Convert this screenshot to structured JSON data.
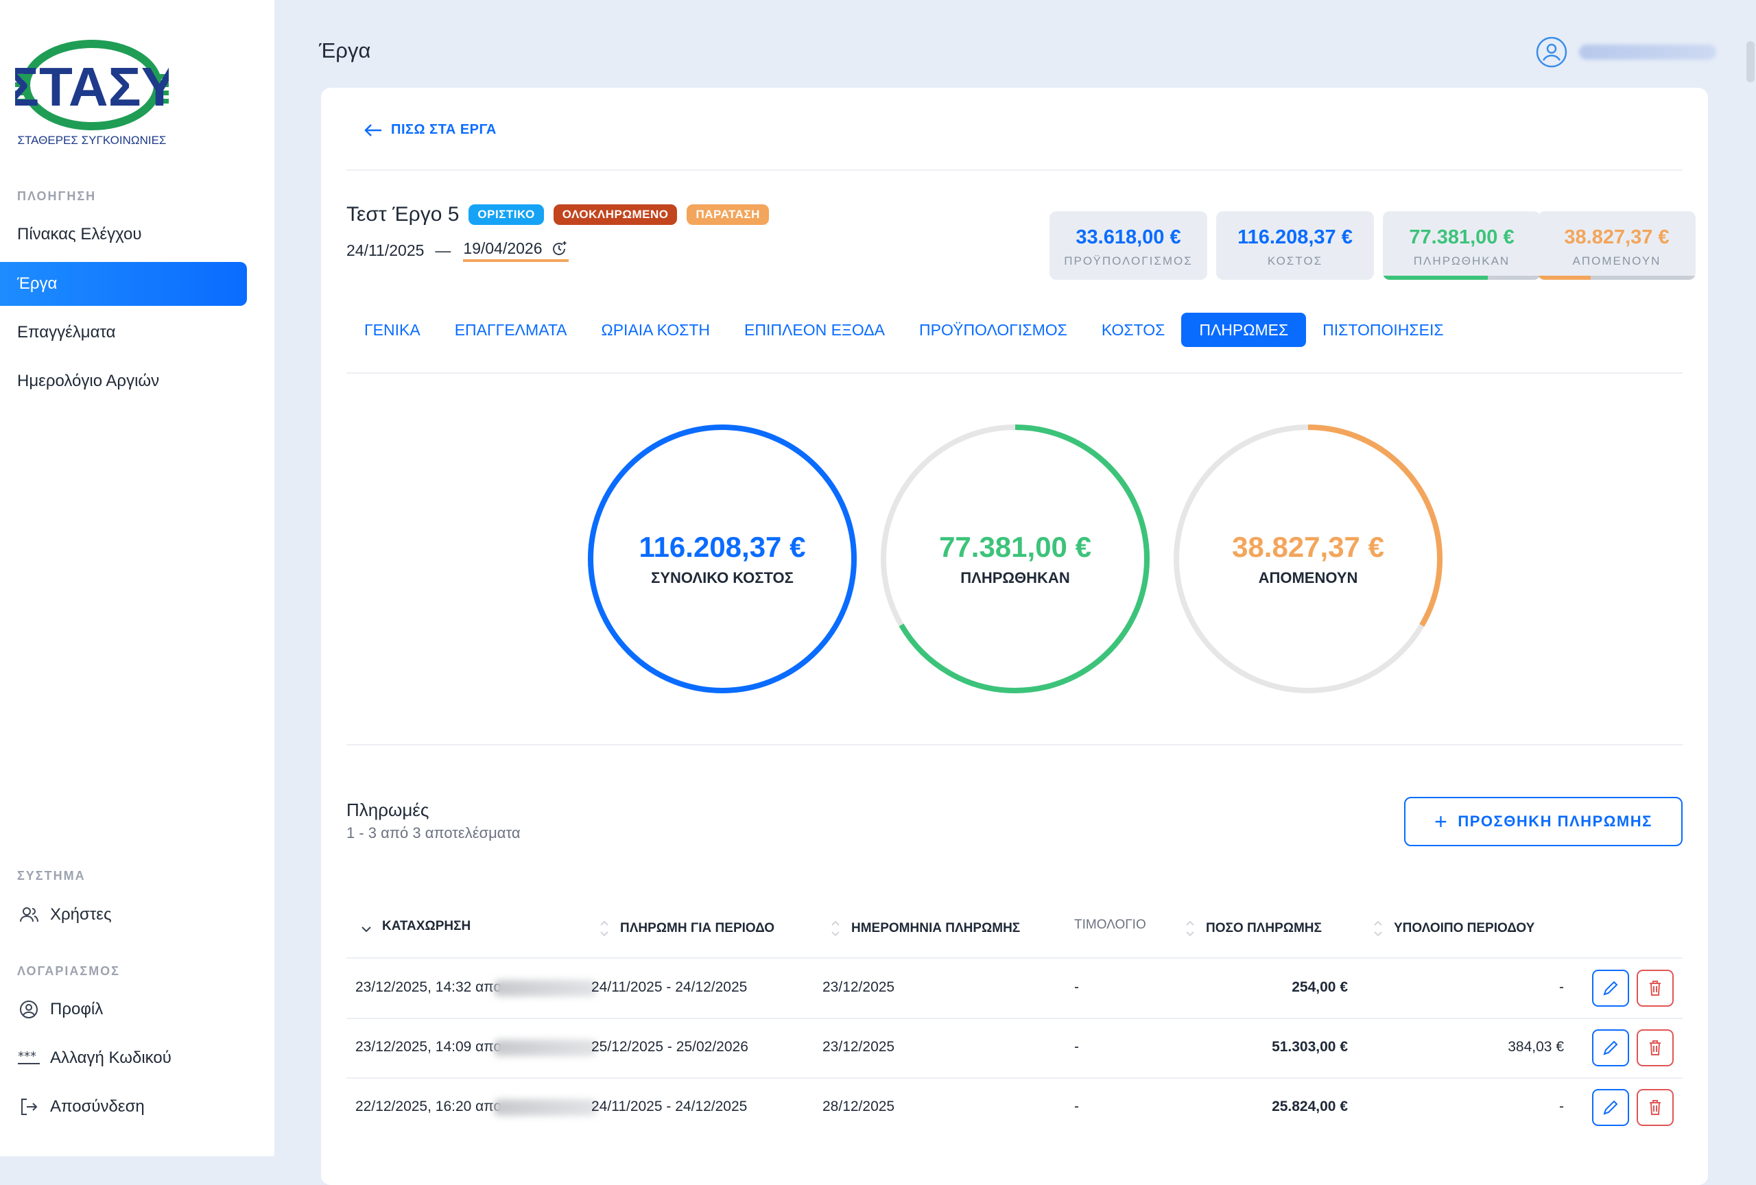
{
  "sidebar": {
    "logo": {
      "text_top": "ΣΤΑΣΥ",
      "text_bottom": "ΣΤΑΘΕΡΕΣ ΣΥΓΚΟΙΝΩΝΙΕΣ"
    },
    "nav_heading": "ΠΛΟΗΓΗΣΗ",
    "nav_items": [
      "Πίνακας Ελέγχου",
      "Έργα",
      "Επαγγέλματα",
      "Ημερολόγιο Αργιών"
    ],
    "system_heading": "ΣΥΣΤΗΜΑ",
    "system_items": [
      {
        "label": "Χρήστες",
        "icon": "users-icon"
      }
    ],
    "account_heading": "ΛΟΓΑΡΙΑΣΜΟΣ",
    "account_items": [
      {
        "label": "Προφίλ",
        "icon": "profile-icon"
      },
      {
        "label": "Αλλαγή Κωδικού",
        "icon": "password-icon"
      },
      {
        "label": "Αποσύνδεση",
        "icon": "logout-icon"
      }
    ]
  },
  "header": {
    "title": "Έργα"
  },
  "back_link": "ΠΙΣΩ ΣΤΑ ΕΡΓΑ",
  "project": {
    "title": "Τεστ Έργο 5",
    "badges": [
      {
        "label": "ΟΡΙΣΤΙΚΟ",
        "color": "#16a3f5"
      },
      {
        "label": "ΟΛΟΚΛΗΡΩΜΕΝΟ",
        "color": "#c2451e"
      },
      {
        "label": "ΠΑΡΑΤΑΣΗ",
        "color": "#f3a55b"
      }
    ],
    "start_date": "24/11/2025",
    "date_separator": "—",
    "end_date": "19/04/2026"
  },
  "stats": [
    {
      "value": "33.618,00 €",
      "label": "ΠΡΟΫΠΟΛΟΓΙΣΜΟΣ",
      "color": "#0a6cff"
    },
    {
      "value": "116.208,37 €",
      "label": "ΚΟΣΤΟΣ",
      "color": "#0a6cff"
    },
    {
      "value": "77.381,00 €",
      "label": "ΠΛΗΡΩΘΗΚΑΝ",
      "color": "#3cc37a",
      "progress": 0.666
    },
    {
      "value": "38.827,37 €",
      "label": "ΑΠΟΜΕΝΟΥΝ",
      "color": "#f3a55b",
      "progress": 0.334
    }
  ],
  "tabs": [
    "ΓΕΝΙΚΑ",
    "ΕΠΑΓΓΕΛΜΑΤΑ",
    "ΩΡΙΑΙΑ ΚΟΣΤΗ",
    "ΕΠΙΠΛΕΟΝ ΕΞΟΔΑ",
    "ΠΡΟΫΠΟΛΟΓΙΣΜΟΣ",
    "ΚΟΣΤΟΣ",
    "ΠΛΗΡΩΜΕΣ",
    "ΠΙΣΤΟΠΟΙΗΣΕΙΣ"
  ],
  "active_tab": "ΠΛΗΡΩΜΕΣ",
  "rings": [
    {
      "value": "116.208,37 €",
      "label": "ΣΥΝΟΛΙΚΟ ΚΟΣΤΟΣ",
      "color": "#0a6cff",
      "fraction": 1.0
    },
    {
      "value": "77.381,00 €",
      "label": "ΠΛΗΡΩΘΗΚΑΝ",
      "color": "#3cc37a",
      "fraction": 0.666
    },
    {
      "value": "38.827,37 €",
      "label": "ΑΠΟΜΕΝΟΥΝ",
      "color": "#f3a55b",
      "fraction": 0.334
    }
  ],
  "payments": {
    "title": "Πληρωμές",
    "subtitle": "1 - 3 από 3 αποτελέσματα",
    "add_button": "ΠΡΟΣΘΗΚΗ ΠΛΗΡΩΜΗΣ",
    "columns": [
      "ΚΑΤΑΧΩΡΗΣΗ",
      "ΠΛΗΡΩΜΗ ΓΙΑ ΠΕΡΙΟΔΟ",
      "ΗΜΕΡΟΜΗΝΙΑ ΠΛΗΡΩΜΗΣ",
      "ΤΙΜΟΛΟΓΙΟ",
      "ΠΟΣΟ ΠΛΗΡΩΜΗΣ",
      "ΥΠΟΛΟΙΠΟ ΠΕΡΙΟΔΟΥ"
    ],
    "rows": [
      {
        "entry": "23/12/2025, 14:32 απο",
        "period": "24/11/2025 - 24/12/2025",
        "date": "23/12/2025",
        "invoice": "-",
        "amount": "254,00 €",
        "balance": "-"
      },
      {
        "entry": "23/12/2025, 14:09 απο",
        "period": "25/12/2025 - 25/02/2026",
        "date": "23/12/2025",
        "invoice": "-",
        "amount": "51.303,00 €",
        "balance": "384,03 €"
      },
      {
        "entry": "22/12/2025, 16:20 απο",
        "period": "24/11/2025 - 24/12/2025",
        "date": "28/12/2025",
        "invoice": "-",
        "amount": "25.824,00 €",
        "balance": "-"
      }
    ]
  }
}
